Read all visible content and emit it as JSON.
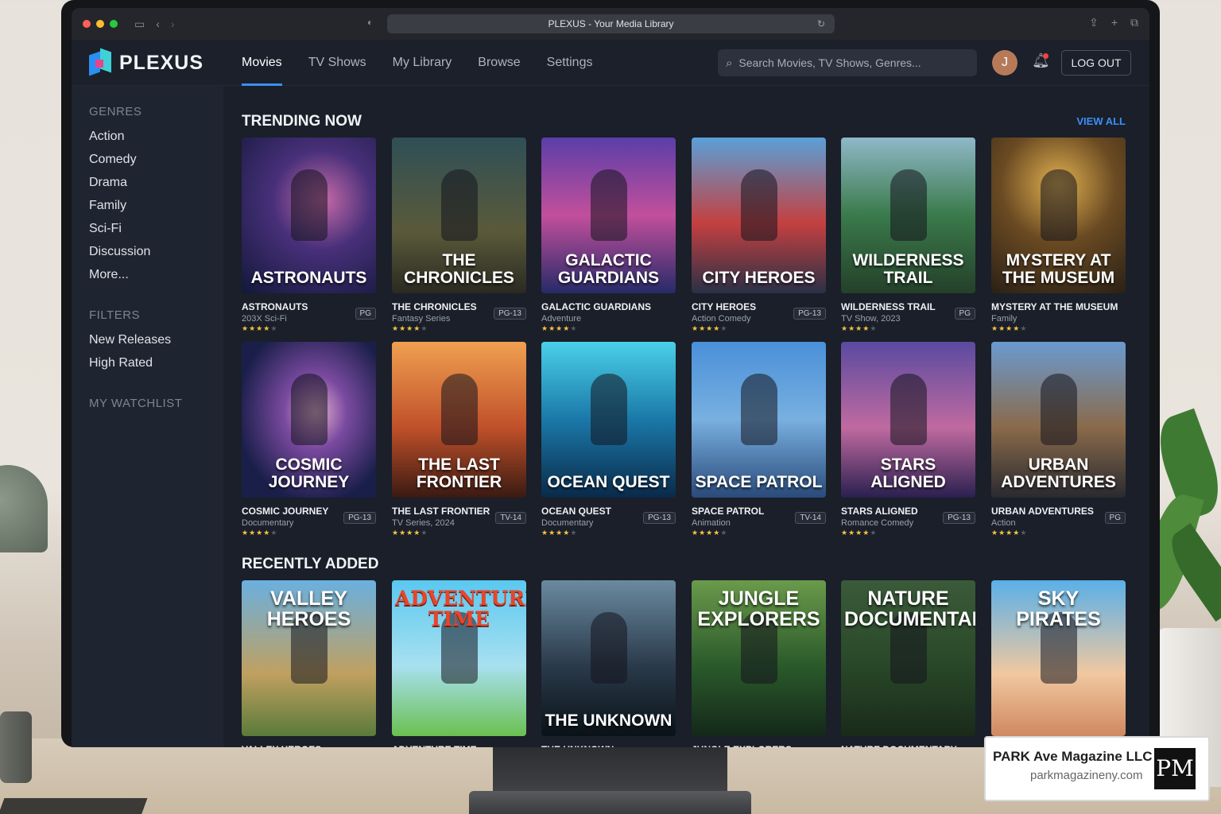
{
  "browser": {
    "tab_title": "PLEXUS - Your Media Library"
  },
  "app": {
    "logo": "PLEXUS",
    "nav": [
      "Movies",
      "TV Shows",
      "My Library",
      "Browse",
      "Settings"
    ],
    "active_nav": "Movies",
    "search_placeholder": "Search Movies, TV Shows, Genres...",
    "avatar_initial": "J",
    "logout_label": "LOG OUT"
  },
  "sidebar": {
    "genres_heading": "GENRES",
    "genres": [
      "Action",
      "Comedy",
      "Drama",
      "Family",
      "Sci-Fi",
      "Discussion",
      "More..."
    ],
    "filters_heading": "FILTERS",
    "filters": [
      "New Releases",
      "High Rated"
    ],
    "watchlist_heading": "MY WATCHLIST"
  },
  "trending": {
    "title": "TRENDING NOW",
    "view_all": "VIEW ALL",
    "items": [
      {
        "poster": "ASTRONAUTS",
        "name": "ASTRONAUTS",
        "sub": "203X Sci-Fi",
        "badge": "PG",
        "rating": 4
      },
      {
        "poster": "THE CHRONICLES",
        "name": "THE CHRONICLES",
        "sub": "Fantasy Series",
        "badge": "PG-13",
        "rating": 4
      },
      {
        "poster": "GALACTIC GUARDIANS",
        "name": "GALACTIC GUARDIANS",
        "sub": "Adventure",
        "badge": "",
        "rating": 4
      },
      {
        "poster": "CITY HEROES",
        "name": "CITY HEROES",
        "sub": "Action Comedy",
        "badge": "PG-13",
        "rating": 4
      },
      {
        "poster": "WILDERNESS TRAIL",
        "name": "WILDERNESS TRAIL",
        "sub": "TV Show, 2023",
        "badge": "PG",
        "rating": 4
      },
      {
        "poster": "MYSTERY AT THE MUSEUM",
        "name": "MYSTERY AT THE MUSEUM",
        "sub": "Family",
        "badge": "",
        "rating": 4
      },
      {
        "poster": "COSMIC JOURNEY",
        "name": "COSMIC JOURNEY",
        "sub": "Documentary",
        "badge": "PG-13",
        "rating": 4
      },
      {
        "poster": "THE LAST FRONTIER",
        "name": "THE LAST FRONTIER",
        "sub": "TV Series, 2024",
        "badge": "TV-14",
        "rating": 4
      },
      {
        "poster": "OCEAN QUEST",
        "name": "OCEAN QUEST",
        "sub": "Documentary",
        "badge": "PG-13",
        "rating": 4
      },
      {
        "poster": "SPACE PATROL",
        "name": "SPACE PATROL",
        "sub": "Animation",
        "badge": "TV-14",
        "rating": 4
      },
      {
        "poster": "STARS ALIGNED",
        "name": "STARS ALIGNED",
        "sub": "Romance Comedy",
        "badge": "PG-13",
        "rating": 4
      },
      {
        "poster": "URBAN ADVENTURES",
        "name": "URBAN ADVENTURES",
        "sub": "Action",
        "badge": "PG",
        "rating": 4
      }
    ]
  },
  "recent": {
    "title": "RECENTLY ADDED",
    "items": [
      {
        "poster": "VALLEY HEROES",
        "name": "VALLEY HEROES"
      },
      {
        "poster": "ADVENTURE TIME",
        "name": "ADVENTURE TIME"
      },
      {
        "poster": "THE UNKNOWN",
        "name": "THE UNKNOWN"
      },
      {
        "poster": "JUNGLE EXPLORERS",
        "name": "JUNGLE EXPLORERS"
      },
      {
        "poster": "NATURE DOCUMENTARY",
        "name": "NATURE DOCUMENTARY"
      },
      {
        "poster": "SKY PIRATES",
        "name": ""
      }
    ]
  },
  "watermark": {
    "name": "PARK Ave Magazine LLC",
    "url": "parkmagazineny.com",
    "logo": "PM"
  },
  "colors": {
    "accent": "#3b8ff5",
    "background": "#1a1f29",
    "sidebar": "#1f2530",
    "star": "#f5c242"
  }
}
